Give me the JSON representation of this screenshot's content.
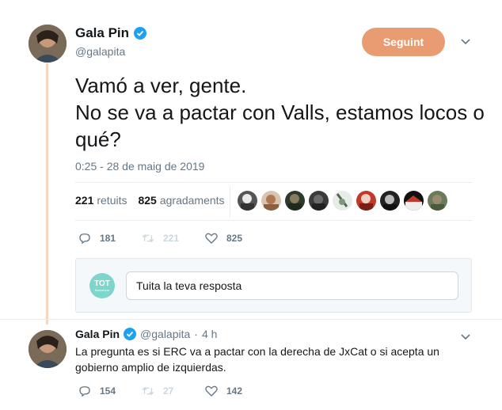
{
  "tweet": {
    "author_name": "Gala Pin",
    "handle": "@galapita",
    "follow_label": "Seguint",
    "text": "Vamó a ver, gente.\nNo se va a pactar con Valls, estamos locos o qué?",
    "timestamp": "0:25 - 28 de maig de 2019",
    "retweets_count": "221",
    "retweets_label": "retuits",
    "likes_count": "825",
    "likes_label": "agradaments",
    "actions": {
      "reply_count": "181",
      "retweet_count": "221",
      "like_count": "825"
    }
  },
  "reply_box": {
    "avatar_text": "TOT",
    "avatar_subtext": "Barcelona",
    "placeholder": "Tuita la teva resposta"
  },
  "reply_tweet": {
    "author_name": "Gala Pin",
    "handle": "@galapita",
    "meta_separator": "·",
    "time": "4 h",
    "text": "La pregunta es si ERC va a pactar con la derecha de JxCat o si acepta un gobierno amplio de izquierdas.",
    "actions": {
      "reply_count": "154",
      "retweet_count": "27",
      "like_count": "142"
    }
  },
  "colors": {
    "follow_button": "#e99c72",
    "thread_line": "#f5d7bd",
    "verified": "#1da1f2",
    "muted_text": "#657786",
    "dim_action": "#ccd6dd"
  },
  "icons": [
    "verified-badge-icon",
    "chevron-down-icon",
    "reply-icon",
    "retweet-icon",
    "heart-icon"
  ]
}
